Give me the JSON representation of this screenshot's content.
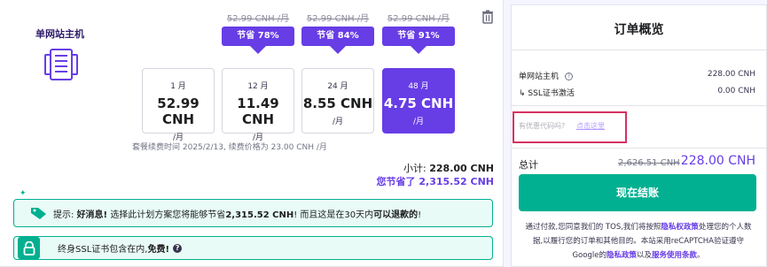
{
  "product": {
    "title": "单网站主机",
    "icon": "server-icon",
    "delete_icon": "trash-icon"
  },
  "periods": [
    {
      "months": "1 月",
      "price": "52.99 CNH",
      "per": "/月",
      "old_price": "",
      "promo": "",
      "selected": false
    },
    {
      "months": "12 月",
      "price": "11.49 CNH",
      "per": "/月",
      "old_price": "52.99 CNH /月",
      "promo": "节省 78%",
      "selected": false
    },
    {
      "months": "24 月",
      "price": "8.55 CNH",
      "per": "/月",
      "old_price": "52.99 CNH /月",
      "promo": "节省 84%",
      "selected": false
    },
    {
      "months": "48 月",
      "price": "4.75 CNH",
      "per": "/月",
      "old_price": "52.99 CNH /月",
      "promo": "节省 91%",
      "selected": true
    }
  ],
  "renewal_text": "套餐续费时间 2025/2/13, 续费价格为 23.00 CNH /月",
  "subtotal": {
    "label": "小计:",
    "value": "228.00 CNH"
  },
  "savings": {
    "label": "您节省了",
    "value": "2,315.52 CNH"
  },
  "tip": {
    "prefix": "提示:",
    "good_news": "好消息!",
    "text_1": "选择此计划方案您将能够节省",
    "amount": "2,315.52 CNH",
    "text_2": "! 而且这是在30天内",
    "refund": "可以退款的",
    "end": "!"
  },
  "ssl": {
    "text": "终身SSL证书包含在内,",
    "free": "免费!",
    "help": "?"
  },
  "summary": {
    "title": "订单概览",
    "lines": [
      {
        "name": "单网站主机",
        "value": "228.00 CNH"
      },
      {
        "name": "↳ SSL证书激活",
        "value": "0.00 CNH"
      }
    ],
    "coupon_question": "有优惠代码吗?",
    "coupon_link": "点击这里",
    "total_label": "总计",
    "total_old": "2,626.51 CNH",
    "total_new": "228.00 CNH",
    "checkout_label": "现在结账",
    "legal_1": "通过付款,您同意我们的 TOS,我们将按照",
    "legal_privacy": "隐私权政策",
    "legal_2": "处理您的个人数据,以履行您的订单和其他目的。本站采用reCAPTCHA验证遵守Google的",
    "legal_gprivacy": "隐私政策",
    "legal_3": "以及",
    "legal_terms": "服务使用条款",
    "legal_4": "。"
  },
  "colors": {
    "accent": "#673de6",
    "success": "#00b090",
    "highlight_border": "#d63163"
  }
}
